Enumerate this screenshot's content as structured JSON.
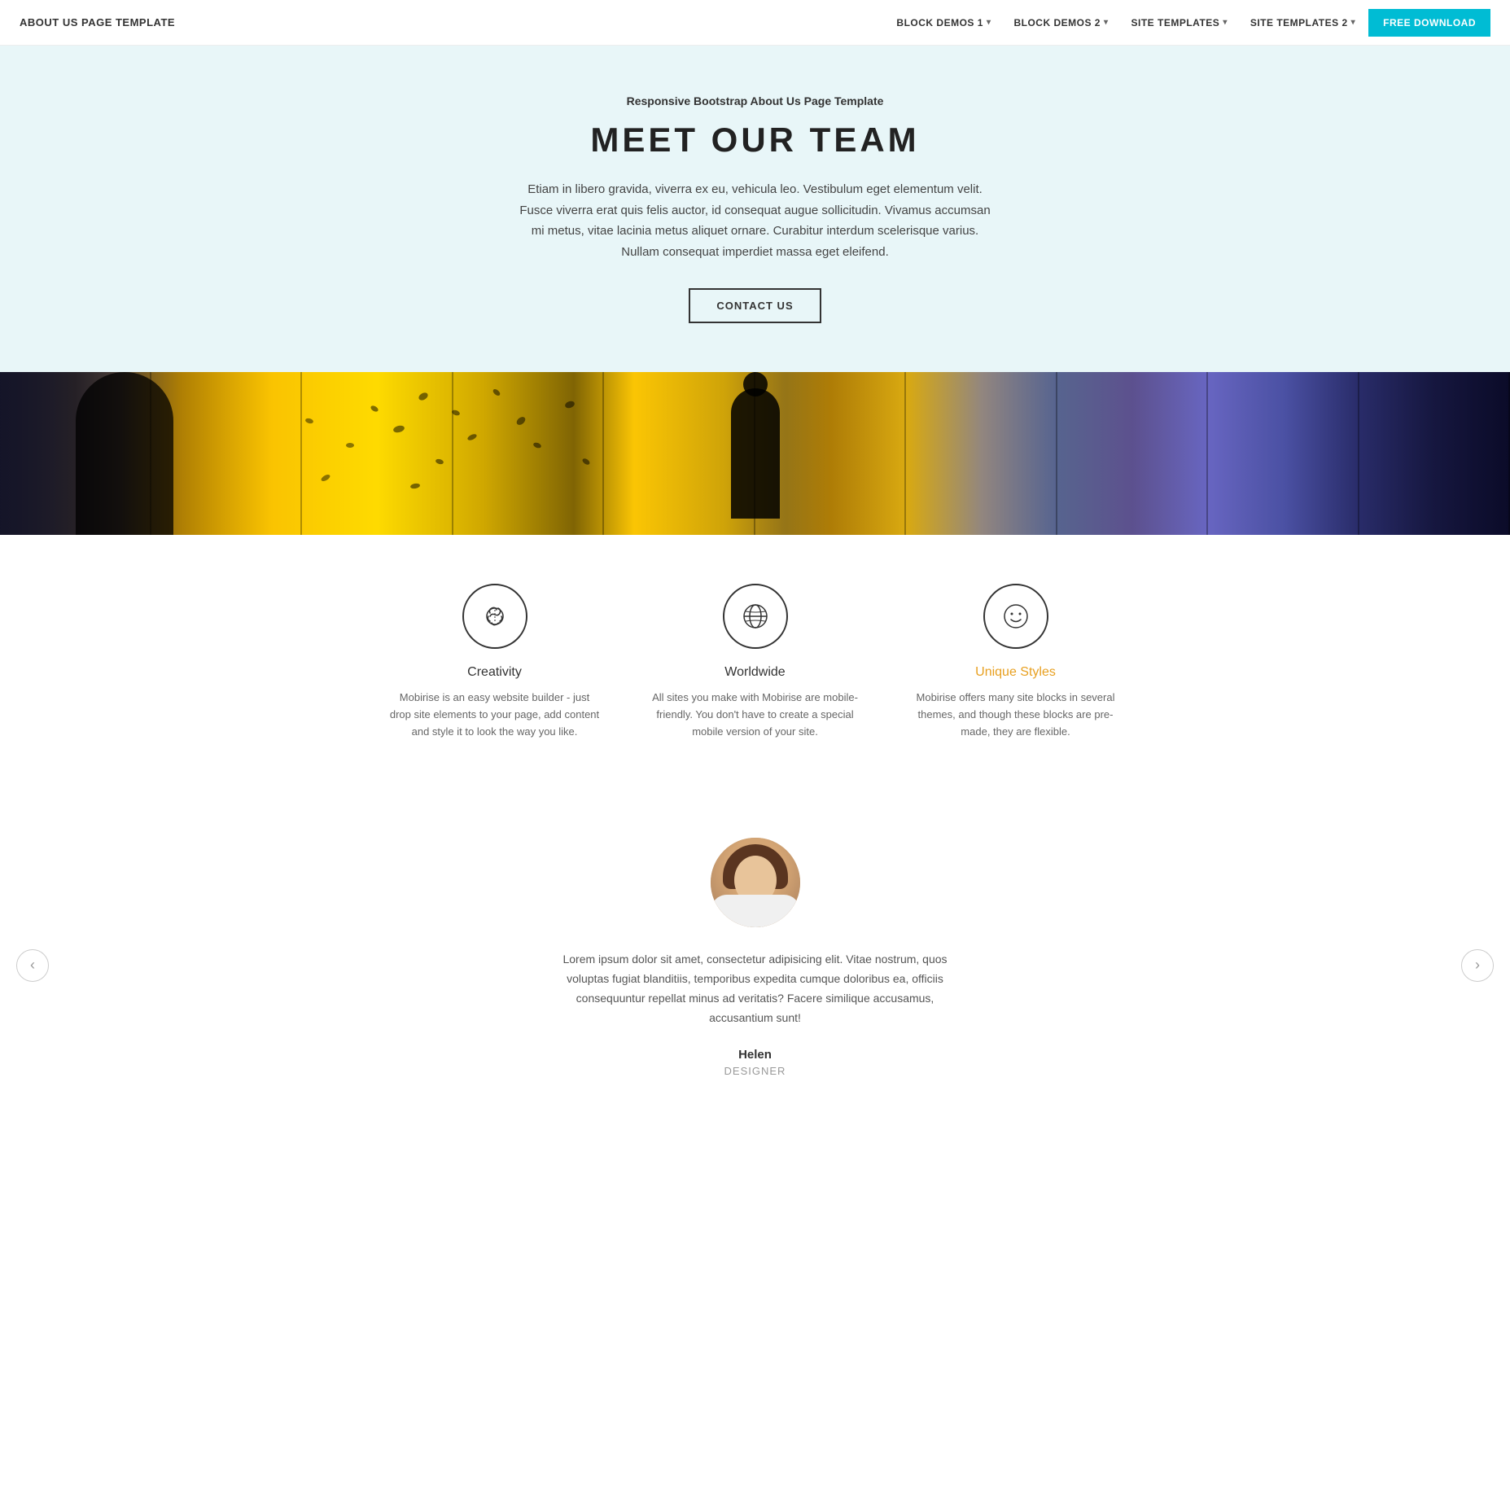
{
  "navbar": {
    "brand": "ABOUT US PAGE TEMPLATE",
    "items": [
      {
        "label": "BLOCK DEMOS 1",
        "has_dropdown": true
      },
      {
        "label": "BLOCK DEMOS 2",
        "has_dropdown": true
      },
      {
        "label": "SITE TEMPLATES",
        "has_dropdown": true
      },
      {
        "label": "SITE TEMPLATES 2",
        "has_dropdown": true
      }
    ],
    "cta_label": "FREE DOWNLOAD"
  },
  "hero": {
    "subtitle": "Responsive Bootstrap About Us Page Template",
    "title": "MEET OUR TEAM",
    "description": "Etiam in libero gravida, viverra ex eu, vehicula leo. Vestibulum eget elementum velit. Fusce viverra erat quis felis auctor, id consequat augue sollicitudin. Vivamus accumsan mi metus, vitae lacinia metus aliquet ornare. Curabitur interdum scelerisque varius. Nullam consequat imperdiet massa eget eleifend.",
    "cta_label": "CONTACT US"
  },
  "features": {
    "items": [
      {
        "id": "creativity",
        "title": "Creativity",
        "accent": false,
        "description": "Mobirise is an easy website builder - just drop site elements to your page, add content and style it to look the way you like.",
        "icon": "brain"
      },
      {
        "id": "worldwide",
        "title": "Worldwide",
        "accent": false,
        "description": "All sites you make with Mobirise are mobile-friendly. You don't have to create a special mobile version of your site.",
        "icon": "globe"
      },
      {
        "id": "unique-styles",
        "title": "Unique Styles",
        "accent": true,
        "description": "Mobirise offers many site blocks in several themes, and though these blocks are pre-made, they are flexible.",
        "icon": "smiley"
      }
    ]
  },
  "testimonial": {
    "quote": "Lorem ipsum dolor sit amet, consectetur adipisicing elit. Vitae nostrum, quos voluptas fugiat blanditiis, temporibus expedita cumque doloribus ea, officiis consequuntur repellat minus ad veritatis? Facere similique accusamus, accusantium sunt!",
    "name": "Helen",
    "role": "DESIGNER",
    "prev_label": "‹",
    "next_label": "›"
  }
}
